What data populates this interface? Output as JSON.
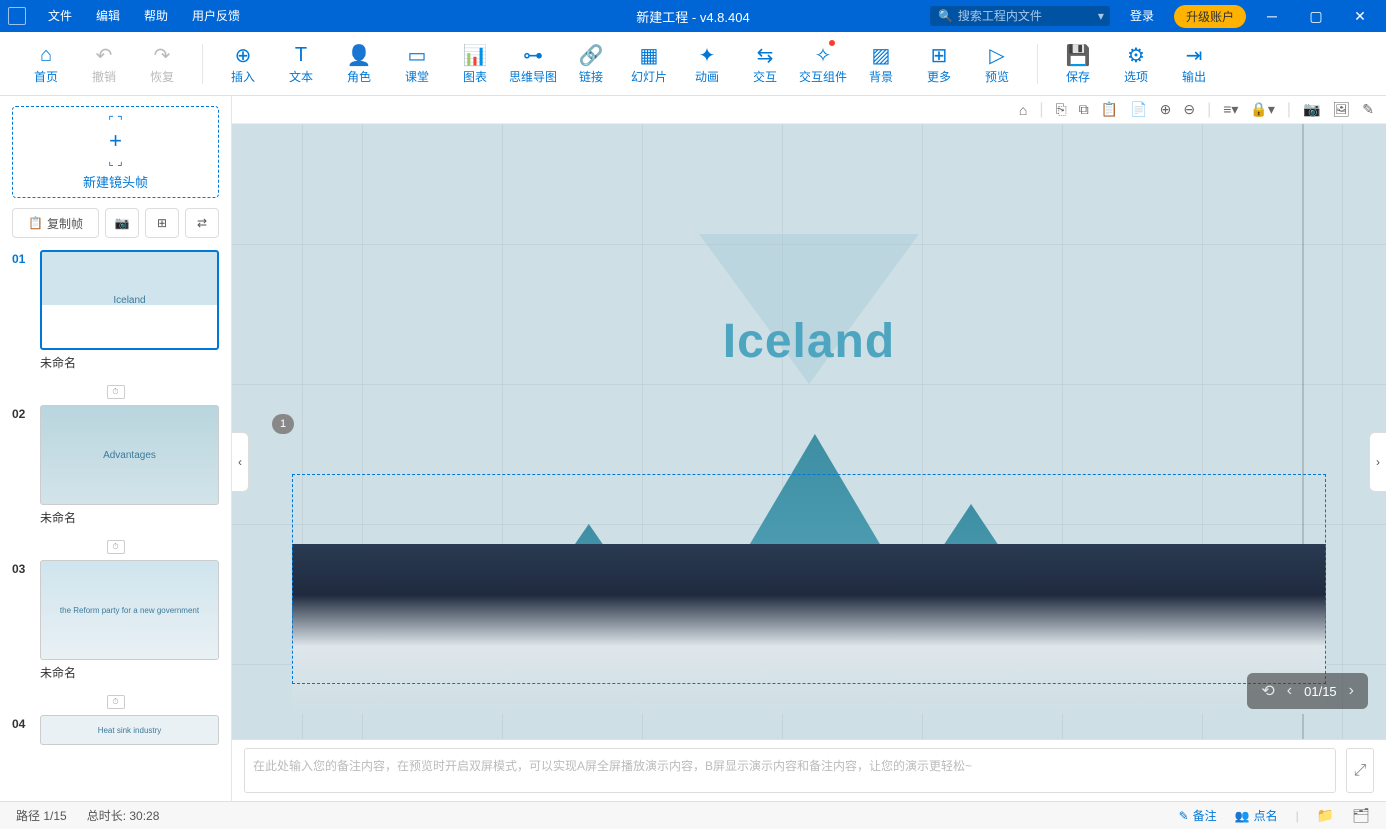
{
  "title": "新建工程 - v4.8.404",
  "menus": {
    "file": "文件",
    "edit": "编辑",
    "help": "帮助",
    "feedback": "用户反馈"
  },
  "search": {
    "placeholder": "搜索工程内文件"
  },
  "login": "登录",
  "upgrade": "升级账户",
  "toolbar": {
    "home": "首页",
    "undo": "撤销",
    "redo": "恢复",
    "insert": "插入",
    "text": "文本",
    "role": "角色",
    "class": "课堂",
    "chart": "图表",
    "mindmap": "思维导图",
    "link": "链接",
    "slide": "幻灯片",
    "anim": "动画",
    "interact": "交互",
    "components": "交互组件",
    "bg": "背景",
    "more": "更多",
    "preview": "预览",
    "save": "保存",
    "options": "选项",
    "output": "输出"
  },
  "sidebar": {
    "new_frame": "新建镜头帧",
    "copy_frame": "复制帧",
    "slides": [
      {
        "num": "01",
        "label": "未命名",
        "title": "Iceland"
      },
      {
        "num": "02",
        "label": "未命名",
        "title": "Advantages"
      },
      {
        "num": "03",
        "label": "未命名",
        "title": "the Reform party for a new government"
      },
      {
        "num": "04",
        "label": "",
        "title": "Heat sink industry"
      }
    ]
  },
  "canvas": {
    "title": "Iceland",
    "frame_num": "1",
    "nav": "01/15"
  },
  "notes": {
    "placeholder": "在此处输入您的备注内容，在预览时开启双屏模式，可以实现A屏全屏播放演示内容，B屏显示演示内容和备注内容，让您的演示更轻松~"
  },
  "status": {
    "path": "路径 1/15",
    "duration": "总时长: 30:28",
    "notes": "备注",
    "roll": "点名"
  }
}
